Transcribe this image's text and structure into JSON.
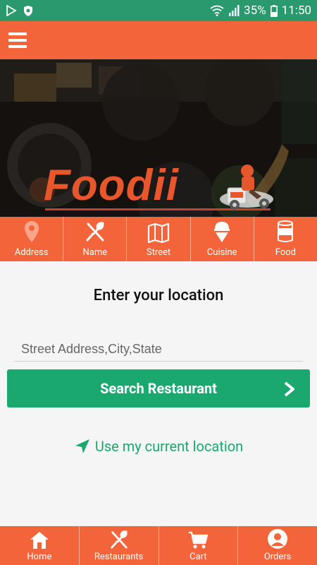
{
  "status_bar": {
    "battery": "35%",
    "time": "11:50"
  },
  "hero": {
    "logo_text": "Foodii"
  },
  "categories": [
    {
      "label": "Address",
      "icon": "map-pin-icon"
    },
    {
      "label": "Name",
      "icon": "fork-spoon-icon"
    },
    {
      "label": "Street",
      "icon": "map-icon"
    },
    {
      "label": "Cuisine",
      "icon": "ice-cream-icon"
    },
    {
      "label": "Food",
      "icon": "can-icon"
    }
  ],
  "main": {
    "heading": "Enter your location",
    "address_placeholder": "Street Address,City,State",
    "search_button": "Search Restaurant",
    "current_location": "Use my current location"
  },
  "bottom_nav": [
    {
      "label": "Home",
      "icon": "home-icon"
    },
    {
      "label": "Restaurants",
      "icon": "fork-spoon-icon"
    },
    {
      "label": "Cart",
      "icon": "cart-icon"
    },
    {
      "label": "Orders",
      "icon": "user-icon"
    }
  ],
  "colors": {
    "primary": "#f4643a",
    "accent": "#1aa86f",
    "status_bar": "#2a9a6e"
  }
}
